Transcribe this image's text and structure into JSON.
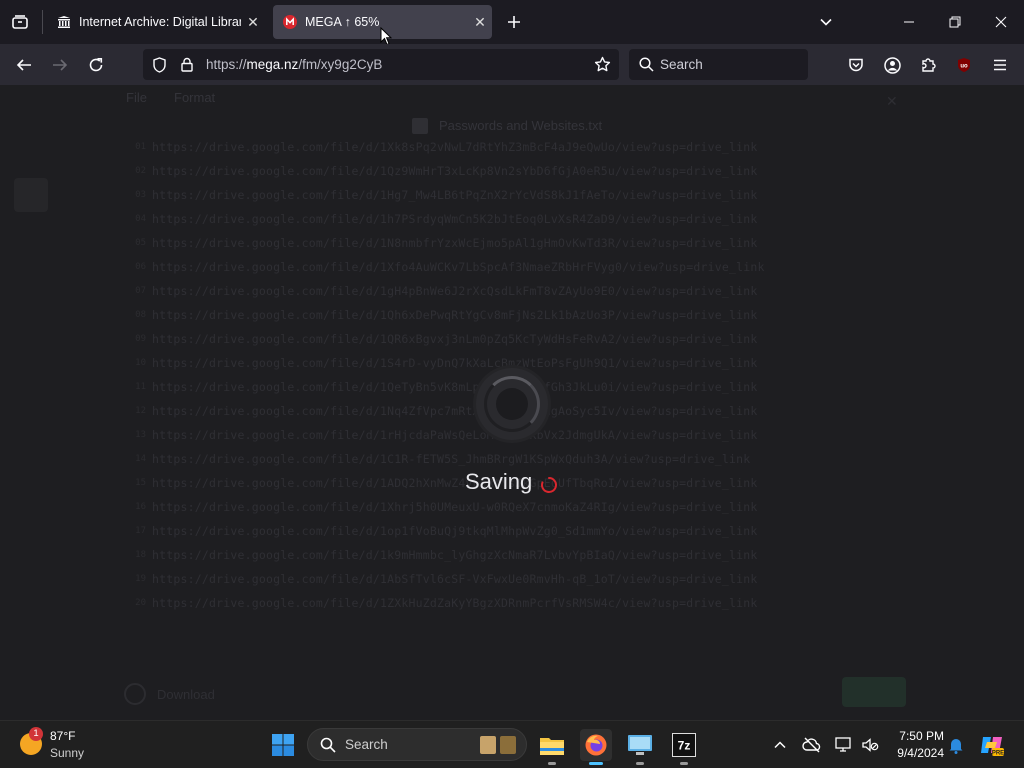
{
  "tabs": [
    {
      "title": "Internet Archive: Digital Library",
      "icon": "archive-building-icon"
    },
    {
      "title": "MEGA ↑ 65%",
      "icon": "mega-logo-icon",
      "active": true
    }
  ],
  "url": {
    "prefix": "https://",
    "host": "mega.nz",
    "path": "/fm/xy9g2CyB"
  },
  "search": {
    "placeholder": "Search"
  },
  "editor": {
    "menu": [
      "File",
      "Format"
    ],
    "filename": "Passwords and Websites.txt",
    "lines": [
      "https://drive.google.com/file/d/1Xk8sPq2vNwL7dRtYhZ3mBcF4aJ9eQwUo/view?usp=drive_link",
      "https://drive.google.com/file/d/1Qz9WmHrT3xLcKp8Vn2sYbD6fGjA0eR5u/view?usp=drive_link",
      "https://drive.google.com/file/d/1Hg7_Mw4LB6tPqZnX2rYcVdS8kJ1fAeTo/view?usp=drive_link",
      "https://drive.google.com/file/d/1h7PSrdyqWmCn5K2bJtEoq0LvXsR4ZaD9/view?usp=drive_link",
      "https://drive.google.com/file/d/1N8nmbfrYzxWcEjmo5pAl1gHmOvKwTd3R/view?usp=drive_link",
      "https://drive.google.com/file/d/1Xfo4AuWCKv7LbSpcAf3NmaeZRbHrFVyg0/view?usp=drive_link",
      "https://drive.google.com/file/d/1gH4pBnWe6J2rXcQsdLkFmT8vZAyUo9E0/view?usp=drive_link",
      "https://drive.google.com/file/d/1Qh6xDePwqRtYgCv8mFjNs2Lk1bAzUo3P/view?usp=drive_link",
      "https://drive.google.com/file/d/1QR6xBgvxj3nLm0pZq5KcTyWdHsFeRvA2/view?usp=drive_link",
      "https://drive.google.com/file/d/1S4rD-vyDnQ7kXaLcBmzWtEoPsFgUh9Q1/view?usp=drive_link",
      "https://drive.google.com/file/d/1QeTyBn5vK8mLpZxWcRoAsDfGh3JkLu0i/view?usp=drive_link",
      "https://drive.google.com/file/d/1Nq4ZfVpc7mRtXwLsKbJdUeHgAoSyc5Iv/view?usp=drive_link",
      "https://drive.google.com/file/d/1rHjcdaPaWsQeLoMnZtY6KbVx2JdmgUkA/view?usp=drive_link",
      "https://drive.google.com/file/d/1C1R-fETW5S_JhmBRrgW1KSpWxQduh3A/view?usp=drive_link",
      "https://drive.google.com/file/d/1ADQ2hXnMwZ4vLcRtYsJkGpEoUfTbqRoI/view?usp=drive_link",
      "https://drive.google.com/file/d/1Xhrj5h0UMeuxU-w0RQeX7cnmoKaZ4RIg/view?usp=drive_link",
      "https://drive.google.com/file/d/1op1fVoBuQj9tkqMlMhpWvZg0_Sd1mmYo/view?usp=drive_link",
      "https://drive.google.com/file/d/1k9mHmmbc_lyGhgzXcNmaR7LvbvYpBIaQ/view?usp=drive_link",
      "https://drive.google.com/file/d/1AbSfTvl6cSF-VxFwxUe0RmvHh-qB_1oT/view?usp=drive_link",
      "https://drive.google.com/file/d/1ZXkHuZdZaKyYBgzXDRnmPcrfVsRMSW4c/view?usp=drive_link"
    ],
    "download_label": "Download"
  },
  "overlay": {
    "saving_text": "Saving"
  },
  "taskbar": {
    "weather": {
      "temp": "87°F",
      "condition": "Sunny",
      "badge": "1"
    },
    "search_label": "Search",
    "time": "7:50 PM",
    "date": "9/4/2024"
  },
  "colors": {
    "mega_red": "#d9272e",
    "firefox_orange": "#ff7139",
    "accent_blue": "#0078d4"
  }
}
